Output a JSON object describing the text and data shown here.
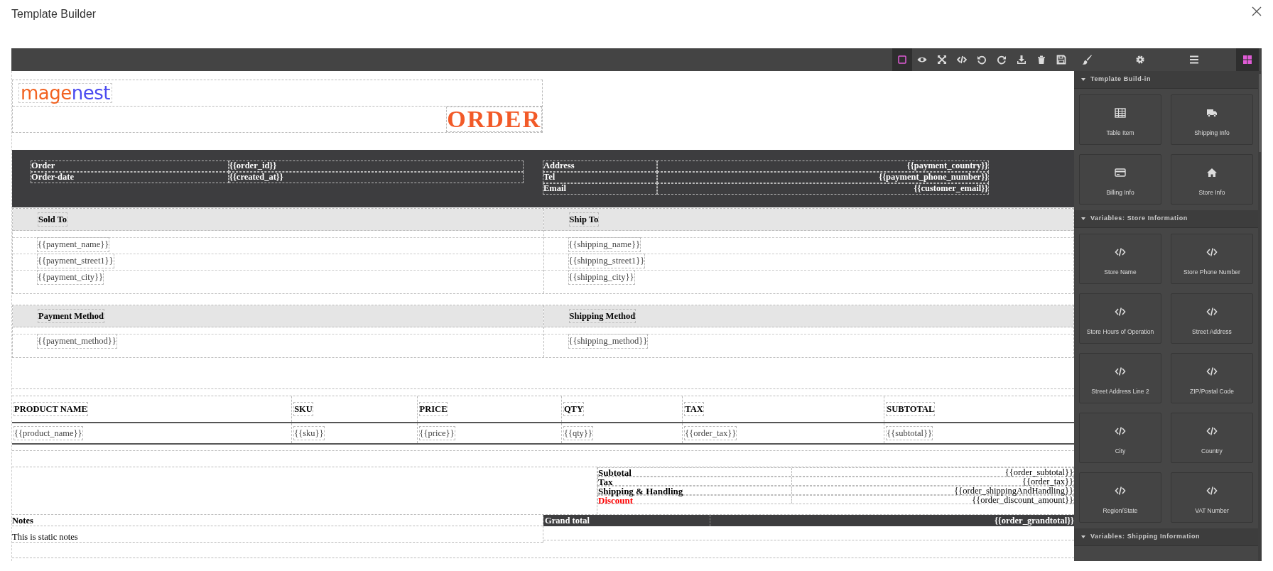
{
  "dialog": {
    "title": "Template Builder"
  },
  "toolbar": {
    "tools": [
      {
        "kind": "outline",
        "selected": true
      },
      {
        "kind": "preview",
        "selected": false
      },
      {
        "kind": "fullscreen",
        "selected": false
      },
      {
        "kind": "code",
        "selected": false
      },
      {
        "kind": "undo",
        "selected": false
      },
      {
        "kind": "redo",
        "selected": false
      },
      {
        "kind": "download",
        "selected": false
      },
      {
        "kind": "delete",
        "selected": false
      },
      {
        "kind": "save",
        "selected": false
      }
    ]
  },
  "panel_tabs": [
    {
      "kind": "style",
      "selected": false
    },
    {
      "kind": "settings",
      "selected": false
    },
    {
      "kind": "layers",
      "selected": false
    },
    {
      "kind": "blocks",
      "selected": true
    }
  ],
  "template": {
    "logo": [
      {
        "text": "mage",
        "color": "#f26322"
      },
      {
        "text": "nest",
        "color": "#4b4bf0"
      }
    ],
    "title": "ORDER",
    "order_info": [
      {
        "label": "Order",
        "value": "{{order_id}}"
      },
      {
        "label": "Order-date",
        "value": "{{created_at}}"
      }
    ],
    "contact_info": [
      {
        "label": "Address",
        "value": "{{payment_country}}"
      },
      {
        "label": "Tel",
        "value": "{{payment_phone_number}}"
      },
      {
        "label": "Email",
        "value": "{{customer_email}}"
      }
    ],
    "addresses": [
      {
        "heading": "Sold To",
        "lines": [
          "{{payment_name}}",
          "{{payment_street1}}",
          "{{payment_city}}"
        ]
      },
      {
        "heading": "Ship To",
        "lines": [
          "{{shipping_name}}",
          "{{shipping_street1}}",
          "{{shipping_city}}"
        ]
      }
    ],
    "methods": [
      {
        "heading": "Payment Method",
        "lines": [
          "{{payment_method}}"
        ]
      },
      {
        "heading": "Shipping Method",
        "lines": [
          "{{shipping_method}}"
        ]
      }
    ],
    "items_table": {
      "columns": [
        "PRODUCT NAME",
        "SKU",
        "PRICE",
        "QTY",
        "TAX",
        "SUBTOTAL"
      ],
      "rows": [
        [
          "{{product_name}}",
          "{{sku}}",
          "{{price}}",
          "{{qty}}",
          "{{order_tax}}",
          "{{subtotal}}"
        ]
      ]
    },
    "totals": [
      {
        "label": "Subtotal",
        "value": "{{order_subtotal}}",
        "highlight": false
      },
      {
        "label": "Tax",
        "value": "{{order_tax}}",
        "highlight": false
      },
      {
        "label": "Shipping & Handling",
        "value": "{{order_shippingAndHandling}}",
        "highlight": false
      },
      {
        "label": "Discount",
        "value": "{{order_discount_amount}}",
        "highlight": true
      }
    ],
    "grand_total": {
      "label": "Grand total",
      "value": "{{order_grandtotal}}"
    },
    "notes": {
      "heading": "Notes",
      "text": "This is static notes"
    }
  },
  "sidebar": {
    "sections": [
      {
        "title": "Template Build-in",
        "expanded": true,
        "blocks": [
          {
            "label": "Table Item",
            "kind": "table"
          },
          {
            "label": "Shipping Info",
            "kind": "truck"
          },
          {
            "label": "Billing Info",
            "kind": "card"
          },
          {
            "label": "Store Info",
            "kind": "home"
          }
        ]
      },
      {
        "title": "Variables: Store Information",
        "expanded": true,
        "blocks": [
          {
            "label": "Store Name",
            "kind": "code"
          },
          {
            "label": "Store Phone Number",
            "kind": "code"
          },
          {
            "label": "Store Hours of Operation",
            "kind": "code"
          },
          {
            "label": "Street Address",
            "kind": "code"
          },
          {
            "label": "Street Address Line 2",
            "kind": "code"
          },
          {
            "label": "ZIP/Postal Code",
            "kind": "code"
          },
          {
            "label": "City",
            "kind": "code"
          },
          {
            "label": "Country",
            "kind": "code"
          },
          {
            "label": "Region/State",
            "kind": "code"
          },
          {
            "label": "VAT Number",
            "kind": "code"
          }
        ]
      },
      {
        "title": "Variables: Shipping Information",
        "expanded": true
      }
    ]
  }
}
